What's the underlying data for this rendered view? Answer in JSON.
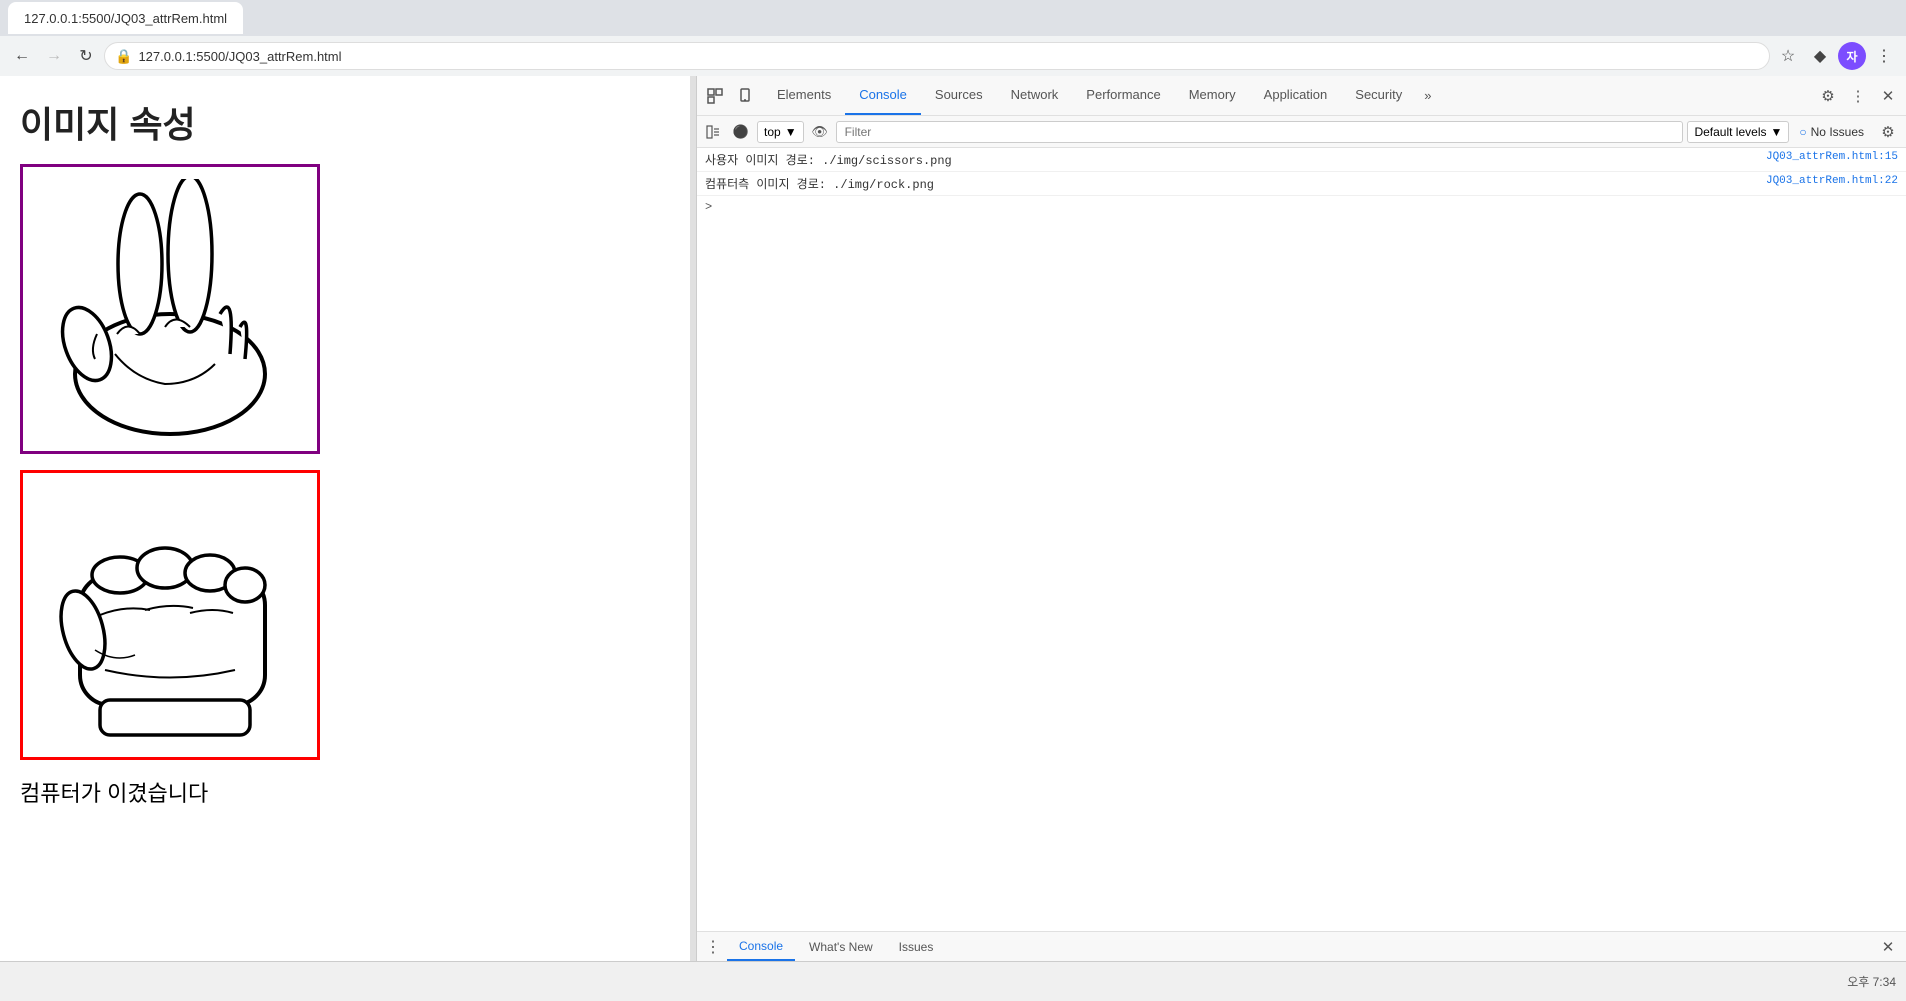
{
  "browser": {
    "url": "127.0.0.1:5500/JQ03_attrRem.html",
    "back_disabled": false,
    "forward_disabled": true
  },
  "page": {
    "title_partial": "이미지 속성",
    "result_text": "컴퓨터가 이겼습니다"
  },
  "devtools": {
    "tabs": [
      {
        "id": "elements",
        "label": "Elements",
        "active": false
      },
      {
        "id": "console",
        "label": "Console",
        "active": true
      },
      {
        "id": "sources",
        "label": "Sources",
        "active": false
      },
      {
        "id": "network",
        "label": "Network",
        "active": false
      },
      {
        "id": "performance",
        "label": "Performance",
        "active": false
      },
      {
        "id": "memory",
        "label": "Memory",
        "active": false
      },
      {
        "id": "application",
        "label": "Application",
        "active": false
      },
      {
        "id": "security",
        "label": "Security",
        "active": false
      }
    ],
    "console": {
      "context": "top",
      "filter_placeholder": "Filter",
      "log_levels": "Default levels",
      "no_issues_label": "No Issues",
      "lines": [
        {
          "text": "사용자 이미지 경로:  ./img/scissors.png",
          "source": "JQ03_attrRem.html:15"
        },
        {
          "text": "컴퓨터측 이미지 경로:  ./img/rock.png",
          "source": "JQ03_attrRem.html:22"
        }
      ]
    },
    "bottom_bar": {
      "tabs": [
        "Console",
        "What's New",
        "Issues"
      ]
    }
  },
  "taskbar": {
    "time": "오후 7:34"
  }
}
